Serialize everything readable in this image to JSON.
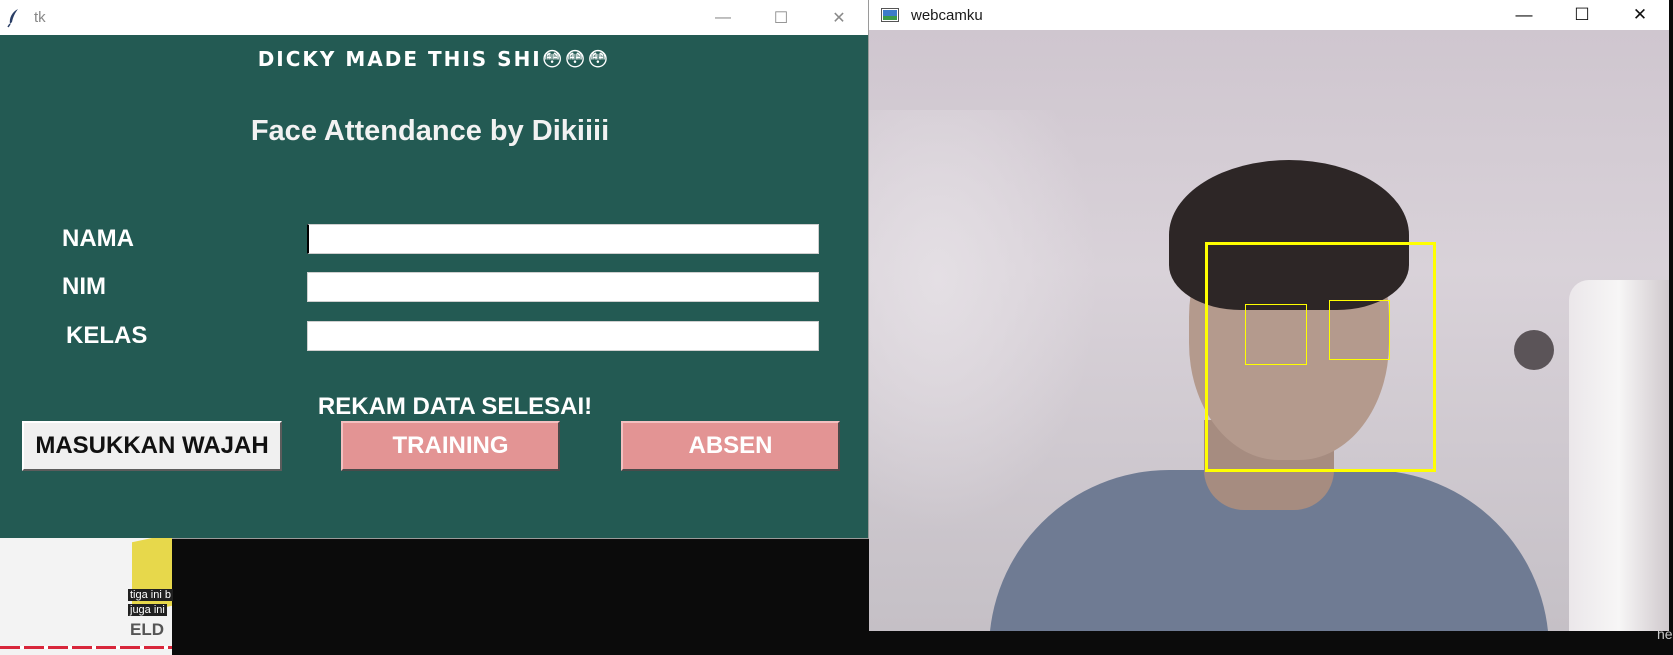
{
  "tk_window": {
    "title": "tk",
    "controls": {
      "minimize": "—",
      "maximize": "☐",
      "close": "✕"
    },
    "banner": "DICKY MADE THIS SHI😳😳😳",
    "app_title": "Face Attendance by Dikiiii",
    "fields": [
      {
        "label": "NAMA",
        "value": ""
      },
      {
        "label": "NIM",
        "value": ""
      },
      {
        "label": "KELAS",
        "value": ""
      }
    ],
    "status": "REKAM DATA SELESAI!",
    "buttons": {
      "masukkan": "MASUKKAN WAJAH",
      "training": "TRAINING",
      "absen": "ABSEN"
    },
    "colors": {
      "background": "#235a53",
      "accent_button": "#e39494"
    }
  },
  "webcam_window": {
    "title": "webcamku",
    "controls": {
      "minimize": "—",
      "maximize": "☐",
      "close": "✕"
    },
    "detections": {
      "faces": 1,
      "eyes": 2,
      "box_color": "#ffff00"
    }
  },
  "background": {
    "thumbnail_captions": [
      "tiga ini b",
      "juga ini"
    ],
    "thumbnail_logo": "ELD",
    "edge_text": "he"
  }
}
